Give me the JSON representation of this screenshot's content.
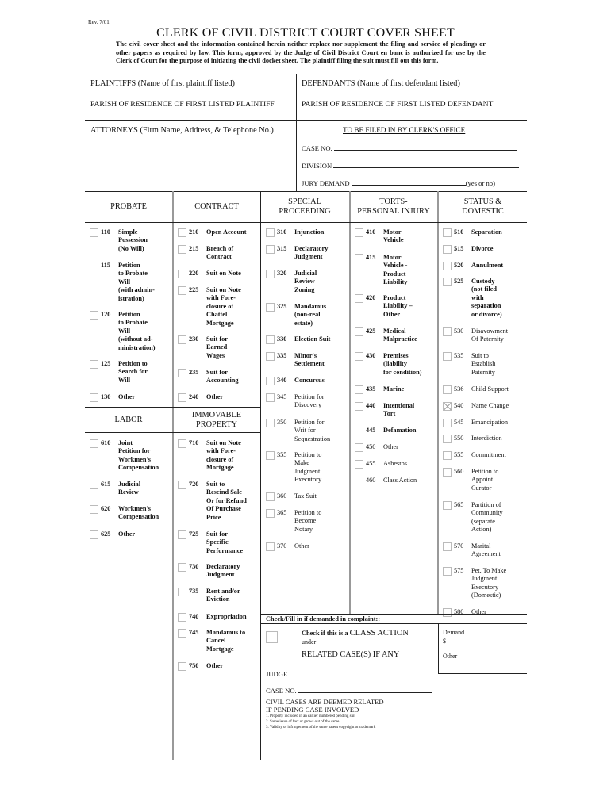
{
  "header": {
    "revision": "Rev. 7/01",
    "title": "CLERK OF CIVIL DISTRICT COURT COVER SHEET",
    "intro": "The civil cover sheet and the information contained herein neither replace nor supplement the filing and service of pleadings or other papers as required by law. This form, approved by the Judge of Civil District Court en banc is authorized for use by the Clerk of Court for the purpose of initiating the civil docket sheet.  The plaintiff filing the suit must fill out this form."
  },
  "parties": {
    "plaintiffs_label": "PLAINTIFFS (Name of first plaintiff listed)",
    "defendants_label": "DEFENDANTS (Name of first defendant listed)",
    "plaintiff_parish_label": "PARISH OF RESIDENCE OF FIRST LISTED PLAINTIFF",
    "defendant_parish_label": "PARISH OF RESIDENCE OF FIRST LISTED DEFENDANT",
    "attorneys_label": "ATTORNEYS (Firm Name, Address, & Telephone No.)"
  },
  "clerk": {
    "heading": "TO BE FILED IN BY CLERK'S OFFICE",
    "case_no_label": "CASE NO.",
    "case_no_value": "",
    "division_label": "DIVISION",
    "division_value": "",
    "jury_demand_label": "JURY DEMAND",
    "jury_demand_value": "",
    "jury_demand_hint": "(yes or no)"
  },
  "columns": [
    {
      "heading": [
        "PROBATE"
      ],
      "items": [
        {
          "code": "110",
          "label": "Simple\nPossession\n(No Will)",
          "bold": true,
          "checked": false
        },
        {
          "code": "115",
          "label": "Petition\nto Probate\nWill\n(with admin-\nistration)",
          "bold": true,
          "checked": false
        },
        {
          "code": "120",
          "label": "Petition\nto Probate\nWill\n(without ad-\nministration)",
          "bold": true,
          "checked": false
        },
        {
          "code": "125",
          "label": "Petition to\nSearch for\nWill",
          "bold": true,
          "checked": false
        },
        {
          "code": "130",
          "label": "Other",
          "bold": true,
          "checked": false
        }
      ]
    },
    {
      "heading": [
        "CONTRACT"
      ],
      "items": [
        {
          "code": "210",
          "label": "Open Account",
          "bold": true,
          "checked": false
        },
        {
          "code": "215",
          "label": "Breach of\nContract",
          "bold": true,
          "checked": false
        },
        {
          "code": "220",
          "label": "Suit on Note",
          "bold": true,
          "checked": false
        },
        {
          "code": "225",
          "label": "Suit on Note\nwith Fore-\nclosure of\nChattel\nMortgage",
          "bold": true,
          "checked": false
        },
        {
          "code": "230",
          "label": "Suit for\nEarned\nWages",
          "bold": true,
          "checked": false
        },
        {
          "code": "235",
          "label": "Suit for\nAccounting",
          "bold": true,
          "checked": false
        },
        {
          "code": "240",
          "label": "Other",
          "bold": true,
          "checked": false
        }
      ]
    },
    {
      "heading": [
        "SPECIAL",
        "PROCEEDING"
      ],
      "items": [
        {
          "code": "310",
          "label": "Injunction",
          "bold": true,
          "checked": false
        },
        {
          "code": "315",
          "label": "Declaratory\nJudgment",
          "bold": true,
          "checked": false
        },
        {
          "code": "320",
          "label": "Judicial\nReview\nZoning",
          "bold": true,
          "checked": false
        },
        {
          "code": "325",
          "label": "Mandamus\n(non-real\nestate)",
          "bold": true,
          "checked": false
        },
        {
          "code": "330",
          "label": "Election Suit",
          "bold": true,
          "checked": false
        },
        {
          "code": "335",
          "label": "Minor's\nSettlement",
          "bold": true,
          "checked": false
        },
        {
          "code": "340",
          "label": "Concursus",
          "bold": true,
          "checked": false
        },
        {
          "code": "345",
          "label": "Petition for\nDiscovery",
          "bold": false,
          "checked": false
        },
        {
          "code": "350",
          "label": "Petition for\nWrit for\nSequestration",
          "bold": false,
          "checked": false
        },
        {
          "code": "355",
          "label": "Petition to\nMake\nJudgment\nExecutory",
          "bold": false,
          "checked": false
        },
        {
          "code": "360",
          "label": "Tax Suit",
          "bold": false,
          "checked": false
        },
        {
          "code": "365",
          "label": "Petition to\nBecome\nNotary",
          "bold": false,
          "checked": false
        },
        {
          "code": "370",
          "label": "Other",
          "bold": false,
          "checked": false
        }
      ]
    },
    {
      "heading": [
        "TORTS-",
        "PERSONAL INJURY"
      ],
      "items": [
        {
          "code": "410",
          "label": "Motor\nVehicle",
          "bold": true,
          "checked": false
        },
        {
          "code": "415",
          "label": "Motor\nVehicle -\nProduct\nLiability",
          "bold": true,
          "checked": false
        },
        {
          "code": "420",
          "label": "Product\nLiability –\nOther",
          "bold": true,
          "checked": false
        },
        {
          "code": "425",
          "label": "Medical\nMalpractice",
          "bold": true,
          "checked": false
        },
        {
          "code": "430",
          "label": "Premises\n(liability\nfor condition)",
          "bold": true,
          "checked": false
        },
        {
          "code": "435",
          "label": "Marine",
          "bold": true,
          "checked": false
        },
        {
          "code": "440",
          "label": "Intentional\nTort",
          "bold": true,
          "checked": false
        },
        {
          "code": "445",
          "label": "Defamation",
          "bold": true,
          "checked": false
        },
        {
          "code": "450",
          "label": "Other",
          "bold": false,
          "checked": false
        },
        {
          "code": "455",
          "label": "Asbestos",
          "bold": false,
          "checked": false
        },
        {
          "code": "460",
          "label": "Class Action",
          "bold": false,
          "checked": false
        }
      ]
    },
    {
      "heading": [
        "STATUS &",
        "DOMESTIC"
      ],
      "items": [
        {
          "code": "510",
          "label": "Separation",
          "bold": true,
          "checked": false
        },
        {
          "code": "515",
          "label": "Divorce",
          "bold": true,
          "checked": false
        },
        {
          "code": "520",
          "label": "Annulment",
          "bold": true,
          "checked": false
        },
        {
          "code": "525",
          "label": "Custody\n(not filed\nwith\nseparation\nor divorce)",
          "bold": true,
          "checked": false
        },
        {
          "code": "530",
          "label": "Disavowment\nOf Paternity",
          "bold": false,
          "checked": false
        },
        {
          "code": "535",
          "label": "Suit to\nEstablish\nPaternity",
          "bold": false,
          "checked": false
        },
        {
          "code": "536",
          "label": "Child Support",
          "bold": false,
          "checked": false
        },
        {
          "code": "540",
          "label": "Name Change",
          "bold": false,
          "checked": true
        },
        {
          "code": "545",
          "label": "Emancipation",
          "bold": false,
          "checked": false
        },
        {
          "code": "550",
          "label": "Interdiction",
          "bold": false,
          "checked": false
        },
        {
          "code": "555",
          "label": "Commitment",
          "bold": false,
          "checked": false
        },
        {
          "code": "560",
          "label": "Petition to\nAppoint\nCurator",
          "bold": false,
          "checked": false
        },
        {
          "code": "565",
          "label": "Partition of\nCommunity\n(separate\nAction)",
          "bold": false,
          "checked": false
        },
        {
          "code": "570",
          "label": "Marital\nAgreement",
          "bold": false,
          "checked": false
        },
        {
          "code": "575",
          "label": "Pet. To Make\nJudgment\nExecutory\n(Domestic)",
          "bold": false,
          "checked": false
        },
        {
          "code": "580",
          "label": "Other",
          "bold": false,
          "checked": false
        }
      ]
    },
    {
      "heading": [
        "LABOR"
      ],
      "items": [
        {
          "code": "610",
          "label": "Joint\nPetition for\nWorkmen's\nCompensation",
          "bold": true,
          "checked": false
        },
        {
          "code": "615",
          "label": "Judicial\nReview",
          "bold": true,
          "checked": false
        },
        {
          "code": "620",
          "label": "Workmen's\n Compensation",
          "bold": true,
          "checked": false
        },
        {
          "code": "625",
          "label": "Other",
          "bold": true,
          "checked": false
        }
      ]
    },
    {
      "heading": [
        "IMMOVABLE",
        "PROPERTY"
      ],
      "items": [
        {
          "code": "710",
          "label": "Suit on Note\nwith Fore-\nclosure of\nMortgage",
          "bold": true,
          "checked": false
        },
        {
          "code": "720",
          "label": "Suit to\nRescind Sale\nOr for Refund\nOf Purchase\nPrice",
          "bold": true,
          "checked": false
        },
        {
          "code": "725",
          "label": "Suit for\nSpecific\nPerformance",
          "bold": true,
          "checked": false
        },
        {
          "code": "730",
          "label": "Declaratory\nJudgment",
          "bold": true,
          "checked": false
        },
        {
          "code": "735",
          "label": "Rent and/or\nEviction",
          "bold": true,
          "checked": false
        },
        {
          "code": "740",
          "label": "Expropriation",
          "bold": true,
          "checked": false
        },
        {
          "code": "745",
          "label": "Mandamus to\nCancel\nMortgage",
          "bold": true,
          "checked": false
        },
        {
          "code": "750",
          "label": "Other",
          "bold": true,
          "checked": false
        }
      ]
    }
  ],
  "complaint": {
    "heading": "Check/Fill in if demanded in complaint::",
    "class_action_prefix": "Check if this is a",
    "class_action_label": "CLASS ACTION",
    "class_action_under": "under",
    "class_action_checked": false,
    "demand_label": "Demand",
    "demand_currency": "$",
    "demand_value": "",
    "other_label": "Other",
    "other_value": ""
  },
  "related": {
    "heading": "RELATED CASE(S) IF ANY",
    "judge_label": "JUDGE",
    "judge_value": "",
    "case_no_label": "CASE NO.",
    "case_no_value": "",
    "deemed_line1": "CIVIL CASES ARE DEEMED RELATED",
    "deemed_line2": "IF PENDING CASE INVOLVED",
    "rules": [
      "1. Property included in an earlier numbered pending suit",
      "2. Same issue of fact or grows out of the same",
      "3. Validity or infringement of the same patent copyright or trademark"
    ]
  }
}
